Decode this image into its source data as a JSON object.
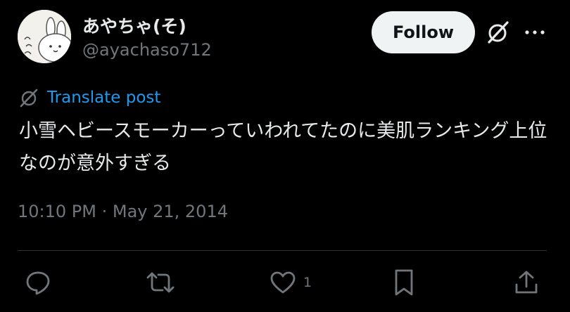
{
  "author": {
    "display_name": "あやちゃ(そ)",
    "handle": "@ayachaso712",
    "avatar_icon": "bunny-avatar-icon"
  },
  "header": {
    "follow_label": "Follow",
    "grok_icon": "grok-icon",
    "more_icon": "more-icon"
  },
  "translate": {
    "icon": "translate-icon",
    "label": "Translate post"
  },
  "post": {
    "text": "小雪ヘビースモーカーっていわれてたのに美肌ランキング上位なのが意外すぎる",
    "timestamp": "10:10 PM · May 21, 2014"
  },
  "actions": {
    "reply_icon": "reply-icon",
    "repost_icon": "repost-icon",
    "like_icon": "heart-icon",
    "like_count": "1",
    "bookmark_icon": "bookmark-icon",
    "share_icon": "share-icon"
  },
  "colors": {
    "background": "#000000",
    "text_primary": "#e7e9ea",
    "text_secondary": "#71767b",
    "link": "#1d9bf0",
    "divider": "#2f3336",
    "follow_bg": "#eff3f4"
  }
}
